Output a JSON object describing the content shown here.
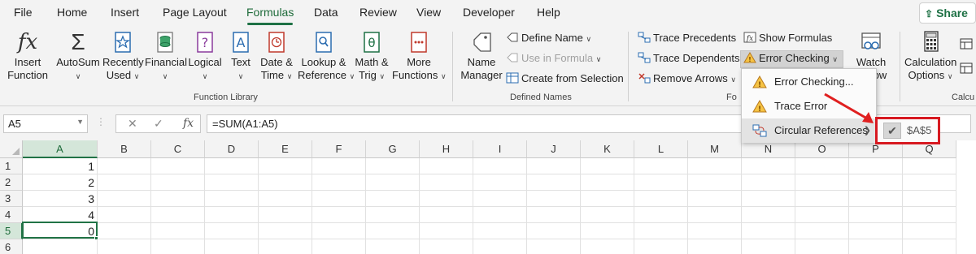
{
  "menu": {
    "tabs": [
      "File",
      "Home",
      "Insert",
      "Page Layout",
      "Formulas",
      "Data",
      "Review",
      "View",
      "Developer",
      "Help"
    ],
    "active": "Formulas",
    "share_label": "Share"
  },
  "ribbon": {
    "insert_function": [
      "Insert",
      "Function"
    ],
    "autosum": "AutoSum",
    "recently_used": [
      "Recently",
      "Used"
    ],
    "financial": "Financial",
    "logical": "Logical",
    "text": "Text",
    "date_time": [
      "Date &",
      "Time"
    ],
    "lookup_reference": [
      "Lookup &",
      "Reference"
    ],
    "math_trig": [
      "Math &",
      "Trig"
    ],
    "more_functions": [
      "More",
      "Functions"
    ],
    "function_library_label": "Function Library",
    "name_manager": [
      "Name",
      "Manager"
    ],
    "define_name": "Define Name",
    "use_in_formula": "Use in Formula",
    "create_from_selection": "Create from Selection",
    "defined_names_label": "Defined Names",
    "trace_precedents": "Trace Precedents",
    "trace_dependents": "Trace Dependents",
    "remove_arrows": "Remove Arrows",
    "show_formulas": "Show Formulas",
    "error_checking": "Error Checking",
    "formula_auditing_label_partial": "Fo",
    "watch_window": [
      "Watch",
      "ow"
    ],
    "calculation_options": [
      "Calculation",
      "Options"
    ],
    "calculation_label_partial": "Calcu"
  },
  "formula_bar": {
    "name_box": "A5",
    "formula": "=SUM(A1:A5)",
    "fx": "fx"
  },
  "columns": [
    "A",
    "B",
    "C",
    "D",
    "E",
    "F",
    "G",
    "H",
    "I",
    "J",
    "K",
    "L",
    "M",
    "N",
    "O",
    "P",
    "Q"
  ],
  "rows": [
    "1",
    "2",
    "3",
    "4",
    "5",
    "6"
  ],
  "cells_A": [
    "1",
    "2",
    "3",
    "4",
    "0",
    ""
  ],
  "active_cell": "A5",
  "dropdown": {
    "items": [
      "Error Checking...",
      "Trace Error",
      "Circular References"
    ]
  },
  "submenu": {
    "item": "$A$5"
  },
  "colors": {
    "accent": "#217346",
    "highlight_red": "#d71920"
  }
}
